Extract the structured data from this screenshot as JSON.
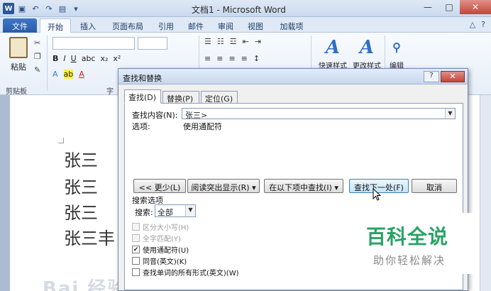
{
  "window": {
    "title": "文档1 - Microsoft Word",
    "controls": [
      "—",
      "□",
      "✕"
    ]
  },
  "ribbon": {
    "tabs": [
      "文件",
      "开始",
      "插入",
      "页面布局",
      "引用",
      "邮件",
      "审阅",
      "视图",
      "加载项"
    ],
    "paste_label": "粘贴",
    "groups": {
      "clipboard": "剪贴板",
      "font": "字"
    },
    "quick_styles": "快速样式",
    "change_styles": "更改样式",
    "edit": "编辑"
  },
  "document": {
    "lines": [
      "张三",
      "张三",
      "张三",
      "张三丰"
    ],
    "watermark": "Bai 经验"
  },
  "dialog": {
    "title": "查找和替换",
    "help_label": "?",
    "close_label": "✕",
    "tabs": [
      "查找(D)",
      "替换(P)",
      "定位(G)"
    ],
    "find_label": "查找内容(N):",
    "find_value": "张三>",
    "options_label": "选项:",
    "options_value": "使用通配符",
    "buttons": {
      "less": "<< 更少(L)",
      "reading_highlight": "阅读突出显示(R) ▾",
      "find_in": "在以下项中查找(I) ▾",
      "find_next": "查找下一处(F)",
      "cancel": "取消"
    },
    "search_options_title": "搜索选项",
    "search_label": "搜索:",
    "search_value": "全部",
    "checkboxes": [
      {
        "label": "区分大小写(H)",
        "checked": false,
        "disabled": true
      },
      {
        "label": "全字匹配(Y)",
        "checked": false,
        "disabled": true
      },
      {
        "label": "使用通配符(U)",
        "checked": true,
        "disabled": false
      },
      {
        "label": "同音(英文)(K)",
        "checked": false,
        "disabled": false
      },
      {
        "label": "查找单词的所有形式(英文)(W)",
        "checked": false,
        "disabled": false
      }
    ]
  },
  "brand": {
    "logo": "百科全说",
    "subtitle": "助你轻松解决"
  }
}
